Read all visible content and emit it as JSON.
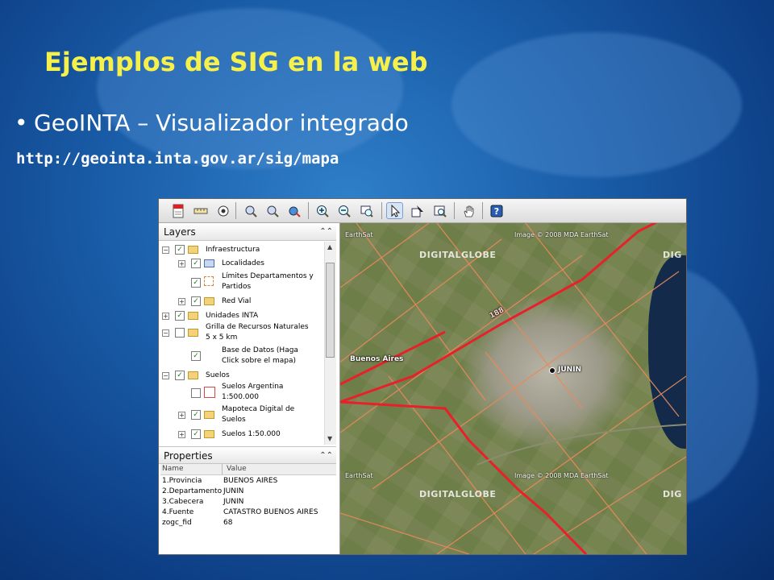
{
  "slide": {
    "title": "Ejemplos de SIG en la web",
    "bullet": "GeoINTA – Visualizador integrado",
    "url": "http://geointa.inta.gov.ar/sig/mapa",
    "colors": {
      "title": "#f5f04a",
      "bullet": "#ffffff",
      "url": "#ffffff",
      "background": "#1a5da8"
    }
  },
  "toolbar": {
    "icons": [
      "pdf-export-icon",
      "measure-ruler-icon",
      "target-icon",
      "zoom-in-rect-icon",
      "zoom-out-rect-icon",
      "pan-globe-icon",
      "zoom-in-icon",
      "zoom-out-icon",
      "zoom-extent-icon",
      "select-pointer-icon",
      "identify-icon",
      "query-icon",
      "hand-pan-icon",
      "help-icon"
    ],
    "selected": "select-pointer-icon"
  },
  "layers_panel": {
    "title": "Layers",
    "items": [
      {
        "label": "Infraestructura",
        "checked": true
      },
      {
        "label": "Localidades",
        "checked": true
      },
      {
        "label": "Límites Departamentos y",
        "checked": true
      },
      {
        "label": "Partidos"
      },
      {
        "label": "Red Vial",
        "checked": true
      },
      {
        "label": "Unidades INTA",
        "checked": true
      },
      {
        "label": "Grilla de Recursos Naturales",
        "checked": false
      },
      {
        "label": "5 x 5 km"
      },
      {
        "label": "Base de Datos (Haga",
        "checked": true
      },
      {
        "label": "Click sobre el mapa)"
      },
      {
        "label": "Suelos",
        "checked": true
      },
      {
        "label": "Suelos Argentina",
        "checked": false
      },
      {
        "label": "1:500.000"
      },
      {
        "label": "Mapoteca Digital de",
        "checked": true
      },
      {
        "label": "Suelos"
      },
      {
        "label": "Suelos 1:50.000",
        "checked": true
      }
    ]
  },
  "properties_panel": {
    "title": "Properties",
    "columns": [
      "Name",
      "Value"
    ],
    "rows": [
      {
        "name": "1.Provincia",
        "value": "BUENOS AIRES"
      },
      {
        "name": "2.Departamento",
        "value": "JUNIN"
      },
      {
        "name": "3.Cabecera",
        "value": "JUNIN"
      },
      {
        "name": "4.Fuente",
        "value": "CATASTRO BUENOS AIRES"
      },
      {
        "name": "zogc_fid",
        "value": "68"
      }
    ]
  },
  "map": {
    "attributions": [
      "Image © 2008 MDA EarthSat",
      "Image © 2008 MDA EarthSat",
      "EarthSat",
      "EarthSat"
    ],
    "watermark": "DIGITALGLOBE",
    "watermark_right": "DIG",
    "labels": {
      "city": "JUNIN",
      "place": "Buenos Aires",
      "route": "188"
    },
    "colors": {
      "roads": "#e8202a",
      "boundaries": "#e88a5a"
    }
  }
}
